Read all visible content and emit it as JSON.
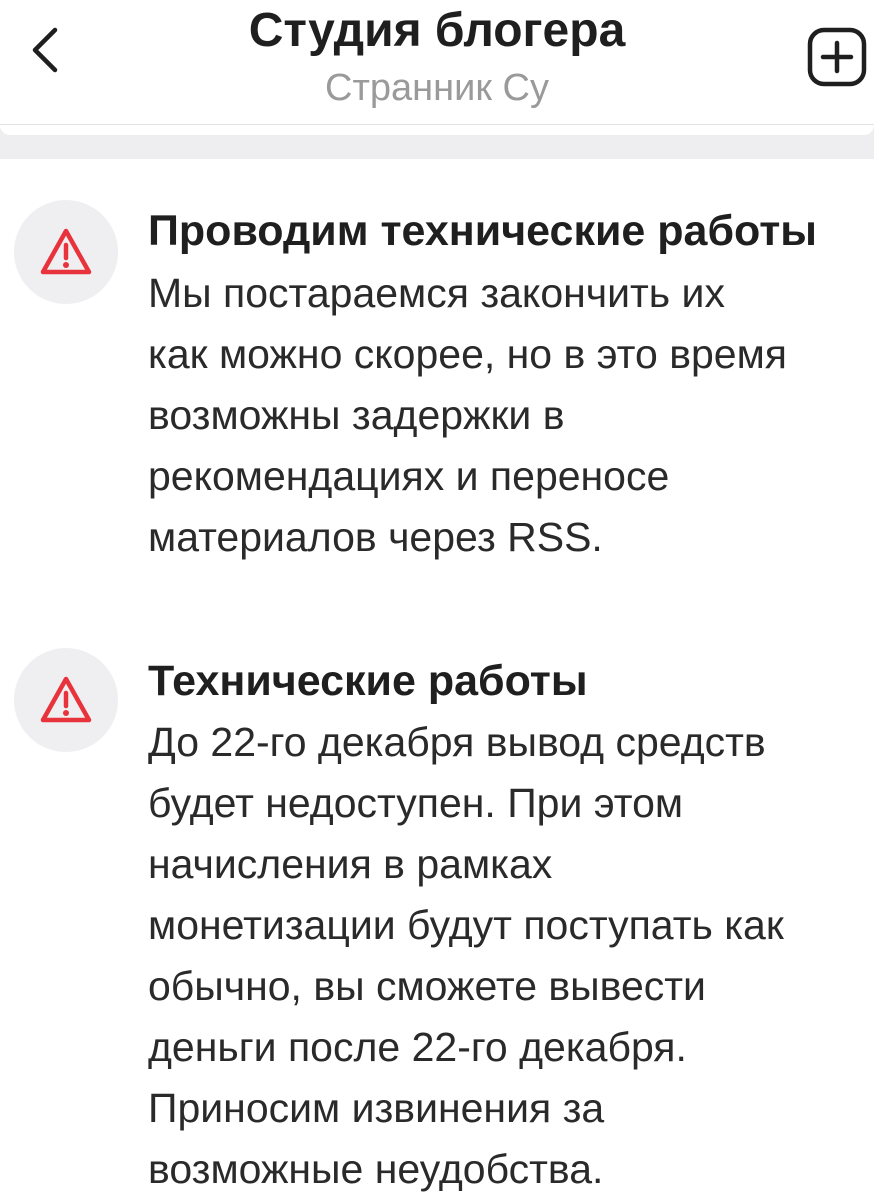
{
  "header": {
    "title": "Студия блогера",
    "subtitle": "Странник Су",
    "back_icon": "chevron-left-icon",
    "add_icon": "plus-square-icon"
  },
  "colors": {
    "warning": "#e8323c",
    "icon_background": "#efeff1",
    "subtitle": "#9a9a9a"
  },
  "notices": [
    {
      "icon": "warning-triangle-icon",
      "title": "Проводим технические работы",
      "body_lines": [
        "Мы постараемся закончить их",
        "как можно скорее, но в это время",
        "возможны задержки в",
        "рекомендациях и переносе",
        "материалов через RSS."
      ]
    },
    {
      "icon": "warning-triangle-icon",
      "title": "Технические работы",
      "body_lines": [
        "До 22-го декабря вывод средств",
        "будет недоступен. При этом",
        "начисления в рамках",
        "монетизации будут поступать как",
        "обычно, вы сможете вывести",
        "деньги после 22-го декабря.",
        "Приносим извинения за",
        "возможные неудобства."
      ]
    }
  ]
}
